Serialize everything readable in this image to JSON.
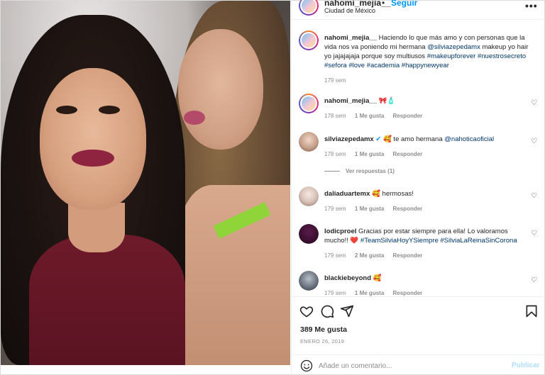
{
  "header": {
    "username": "nahomi_mejia__",
    "separator": "•",
    "follow_label": "Seguir",
    "location": "Ciudad de México",
    "more": "•••"
  },
  "caption": {
    "username": "nahomi_mejia__",
    "text_plain_1": "Haciendo lo que más amo y con personas que la vida nos va poniendo mi hermana",
    "mention": "@silviazepedamx",
    "text_plain_2": "makeup yo hair yo jajajajaja porque soy multiusos",
    "hashtags": "#makeupforever #nuestrosecreto #sefora #love #academia #happynewyear",
    "time": "179 sem"
  },
  "comments": [
    {
      "username": "nahomi_mejia__",
      "text": "🎀🧴",
      "time": "178 sem",
      "likes": "1 Me gusta",
      "reply": "Responder"
    },
    {
      "username": "silviazepedamx",
      "verified": "✔",
      "text": "🥰 te amo hermana",
      "mention": "@nahoticaoficial",
      "time": "178 sem",
      "likes": "1 Me gusta",
      "reply": "Responder",
      "view_replies": "Ver respuestas (1)"
    },
    {
      "username": "daliaduartemx",
      "text": "🥰 hermosas!",
      "time": "179 sem",
      "likes": "1 Me gusta",
      "reply": "Responder"
    },
    {
      "username": "lodicproel",
      "text": "Gracias por estar siempre para ella! Lo valoramos mucho!! ❤️",
      "hashtags": "#TeamSilviaHoyYSiempre #SilviaLaReinaSinCorona",
      "time": "179 sem",
      "likes": "2 Me gusta",
      "reply": "Responder"
    },
    {
      "username": "blackiebeyond",
      "text": "🥰",
      "time": "179 sem",
      "likes": "1 Me gusta",
      "reply": "Responder"
    }
  ],
  "actions": {
    "like": "heart-icon",
    "comment": "comment-icon",
    "share": "send-icon",
    "save": "bookmark-icon"
  },
  "likes_count": "389 Me gusta",
  "post_date": "ENERO 26, 2019",
  "composer": {
    "placeholder": "Añade un comentario...",
    "post_label": "Publicar"
  },
  "colors": {
    "accent": "#0095f6",
    "post_disabled": "#b2dffc",
    "muted": "#8e8e8e",
    "hashtag": "#00376b"
  }
}
